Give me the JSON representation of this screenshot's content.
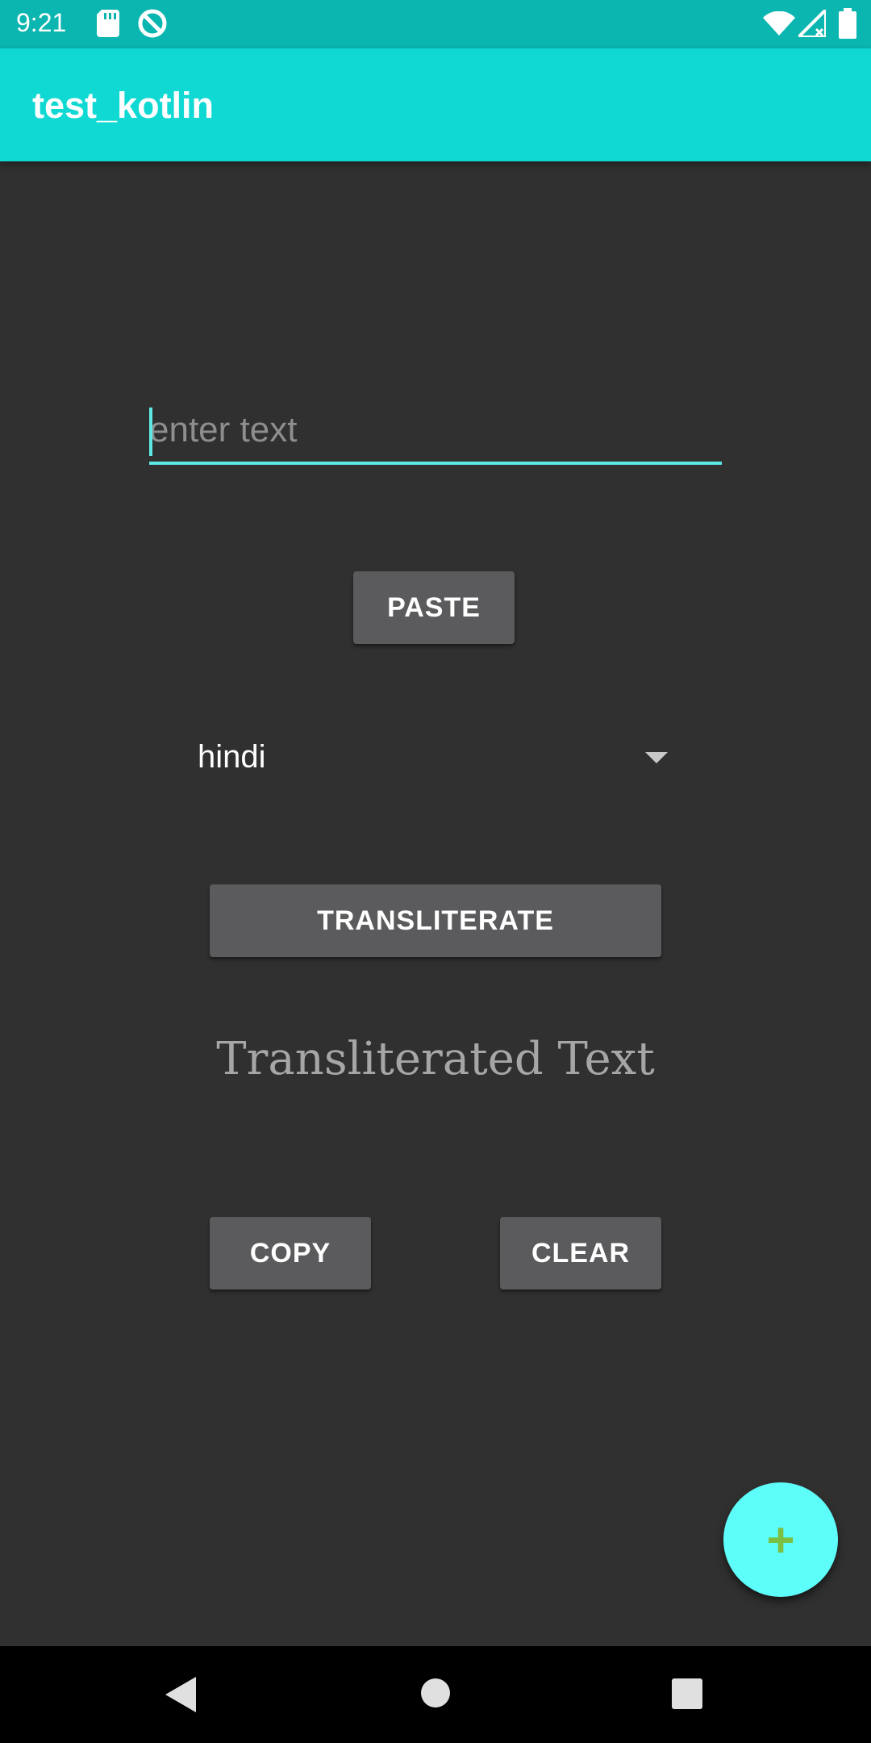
{
  "status_bar": {
    "time": "9:21",
    "icons": [
      "sd-card-icon",
      "sync-icon",
      "wifi-icon",
      "signal-icon",
      "battery-icon"
    ]
  },
  "app_bar": {
    "title": "test_kotlin"
  },
  "input": {
    "placeholder": "enter text",
    "value": ""
  },
  "buttons": {
    "paste": "PASTE",
    "transliterate": "TRANSLITERATE",
    "copy": "COPY",
    "clear": "CLEAR"
  },
  "spinner": {
    "selected": "hindi"
  },
  "result": {
    "text": "Transliterated Text"
  },
  "fab": {
    "icon": "plus-icon",
    "symbol": "+"
  },
  "nav": {
    "icons": [
      "back-icon",
      "home-icon",
      "recents-icon"
    ]
  },
  "colors": {
    "status_bar": "#0bb5b0",
    "app_bar": "#10d8d2",
    "background": "#303030",
    "accent": "#5ee8e5",
    "fab": "#5dfdfa",
    "button": "#5b5b5d"
  }
}
